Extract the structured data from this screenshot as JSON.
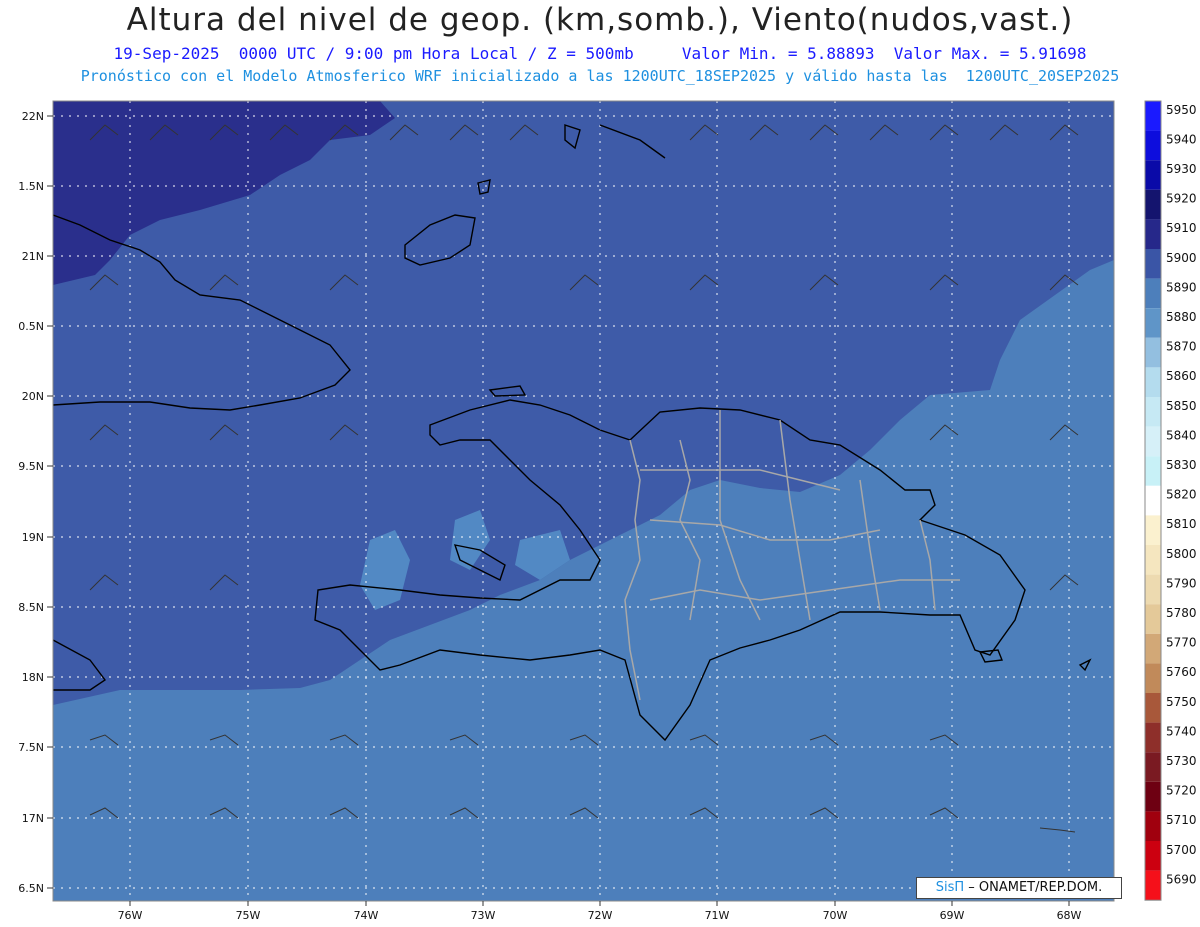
{
  "header": {
    "title": "Altura del nivel de geop. (km,somb.), Viento(nudos,vast.)",
    "subtitle": "19-Sep-2025  0000 UTC / 9:00 pm Hora Local / Z = 500mb     Valor Min. = 5.88893  Valor Max. = 5.91698",
    "model_line": "Pronóstico con el Modelo Atmosferico WRF inicializado a las 1200UTC_18SEP2025 y válido hasta las  1200UTC_20SEP2025"
  },
  "map": {
    "lon_labels": [
      "76W",
      "75W",
      "74W",
      "73W",
      "72W",
      "71W",
      "70W",
      "69W",
      "68W"
    ],
    "lat_labels": [
      "22N",
      "1.5N",
      "21N",
      "0.5N",
      "20N",
      "9.5N",
      "19N",
      "8.5N",
      "18N",
      "7.5N",
      "17N",
      "6.5N"
    ],
    "shading_colors": {
      "ocean_south": "#4d7fbb",
      "mid": "#3e5ba8",
      "north": "#2a2f8c",
      "patch": "#5289c4"
    }
  },
  "colorbar": {
    "levels": [
      "5950",
      "5940",
      "5930",
      "5920",
      "5910",
      "5900",
      "5890",
      "5880",
      "5870",
      "5860",
      "5850",
      "5840",
      "5830",
      "5820",
      "5810",
      "5800",
      "5790",
      "5780",
      "5770",
      "5760",
      "5750",
      "5740",
      "5730",
      "5720",
      "5710",
      "5700",
      "5690"
    ],
    "colors": [
      "#1a1aff",
      "#0d0ddd",
      "#0a0aa8",
      "#14146e",
      "#26288a",
      "#3a55a6",
      "#4d7fbb",
      "#5f95c8",
      "#93bfe0",
      "#b4dcee",
      "#c6e9f4",
      "#d6f0f8",
      "#c8f1f7",
      "#ffffff",
      "#fbf1cf",
      "#f5e6bf",
      "#eddab0",
      "#e4c999",
      "#d2a877",
      "#c18a5a",
      "#a8583a",
      "#8e2f2a",
      "#7a1a22",
      "#6e0012",
      "#a0000e",
      "#cc0010",
      "#f5101a"
    ]
  },
  "footer": {
    "brand": "SisΠ",
    "credit": " – ONAMET/REP.DOM."
  }
}
